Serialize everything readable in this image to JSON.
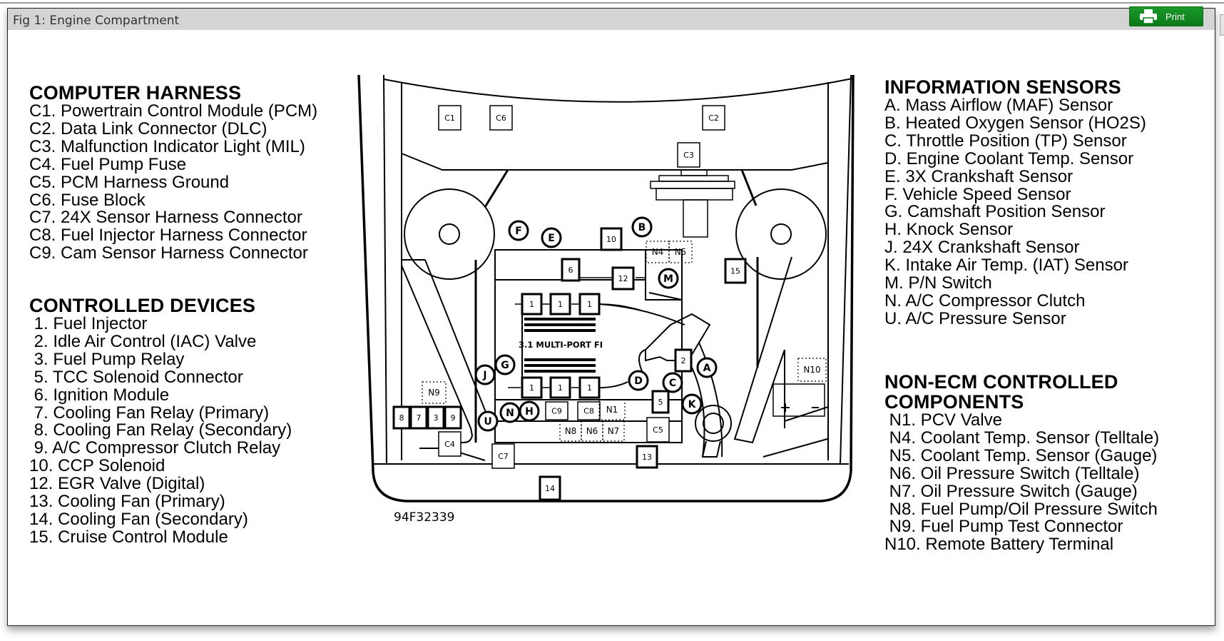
{
  "window": {
    "title": "Fig 1: Engine Compartment",
    "print_label": "Print",
    "print_icon": "printer-icon"
  },
  "computer_harness": {
    "heading": "COMPUTER HARNESS",
    "items": [
      "C1. Powertrain Control Module (PCM)",
      "C2. Data Link Connector (DLC)",
      "C3. Malfunction Indicator Light (MIL)",
      "C4. Fuel Pump Fuse",
      "C5. PCM Harness Ground",
      "C6. Fuse Block",
      "C7. 24X Sensor Harness Connector",
      "C8. Fuel Injector Harness Connector",
      "C9. Cam Sensor Harness Connector"
    ]
  },
  "controlled_devices": {
    "heading": "CONTROLLED DEVICES",
    "items": [
      " 1. Fuel Injector",
      " 2. Idle Air Control (IAC) Valve",
      " 3. Fuel Pump Relay",
      " 5. TCC Solenoid Connector",
      " 6. Ignition Module",
      " 7. Cooling Fan Relay (Primary)",
      " 8. Cooling Fan Relay (Secondary)",
      " 9. A/C Compressor Clutch Relay",
      "10. CCP Solenoid",
      "12. EGR Valve (Digital)",
      "13. Cooling Fan (Primary)",
      "14. Cooling Fan (Secondary)",
      "15. Cruise Control Module"
    ]
  },
  "information_sensors": {
    "heading": "INFORMATION SENSORS",
    "items": [
      "A. Mass Airflow (MAF) Sensor",
      "B. Heated Oxygen Sensor (HO2S)",
      "C. Throttle Position (TP) Sensor",
      "D. Engine Coolant Temp. Sensor",
      "E. 3X Crankshaft Sensor",
      "F. Vehicle Speed Sensor",
      "G. Camshaft Position Sensor",
      "H. Knock Sensor",
      "J. 24X Crankshaft Sensor",
      "K. Intake Air Temp. (IAT) Sensor",
      "M. P/N Switch",
      "N. A/C Compressor Clutch",
      "U. A/C Pressure Sensor"
    ]
  },
  "non_ecm": {
    "heading_line1": "NON-ECM CONTROLLED",
    "heading_line2": "COMPONENTS",
    "items": [
      " N1. PCV Valve",
      " N4. Coolant Temp. Sensor (Telltale)",
      " N5. Coolant Temp. Sensor (Gauge)",
      " N6. Oil Pressure Switch (Telltale)",
      " N7. Oil Pressure Switch (Gauge)",
      " N8. Fuel Pump/Oil Pressure Switch",
      " N9. Fuel Pump Test Connector",
      "N10. Remote Battery Terminal"
    ]
  },
  "diagram": {
    "engine_label": "3.1 MULTI-PORT FI",
    "figure_code": "94F32339",
    "battery_plus": "+",
    "battery_minus": "–",
    "boxes": {
      "c1": "C1",
      "c6": "C6",
      "c2": "C2",
      "c3": "C3",
      "c4": "C4",
      "c5": "C5",
      "c7": "C7",
      "c8": "C8",
      "c9": "C9",
      "d10": "10",
      "d6": "6",
      "d12": "12",
      "d15": "15",
      "d2": "2",
      "d5": "5",
      "d13": "13",
      "d14": "14",
      "d8": "8",
      "d7": "7",
      "d3": "3",
      "d9": "9",
      "inj": "1"
    },
    "dotted": {
      "n4": "N4",
      "n5": "N5",
      "n1": "N1",
      "n6": "N6",
      "n7": "N7",
      "n8": "N8",
      "n9": "N9",
      "n10": "N10"
    },
    "circles": {
      "f": "F",
      "e": "E",
      "b": "B",
      "m": "M",
      "g": "G",
      "j": "J",
      "d": "D",
      "c": "C",
      "a": "A",
      "k": "K",
      "u": "U",
      "n": "N",
      "h": "H"
    }
  }
}
